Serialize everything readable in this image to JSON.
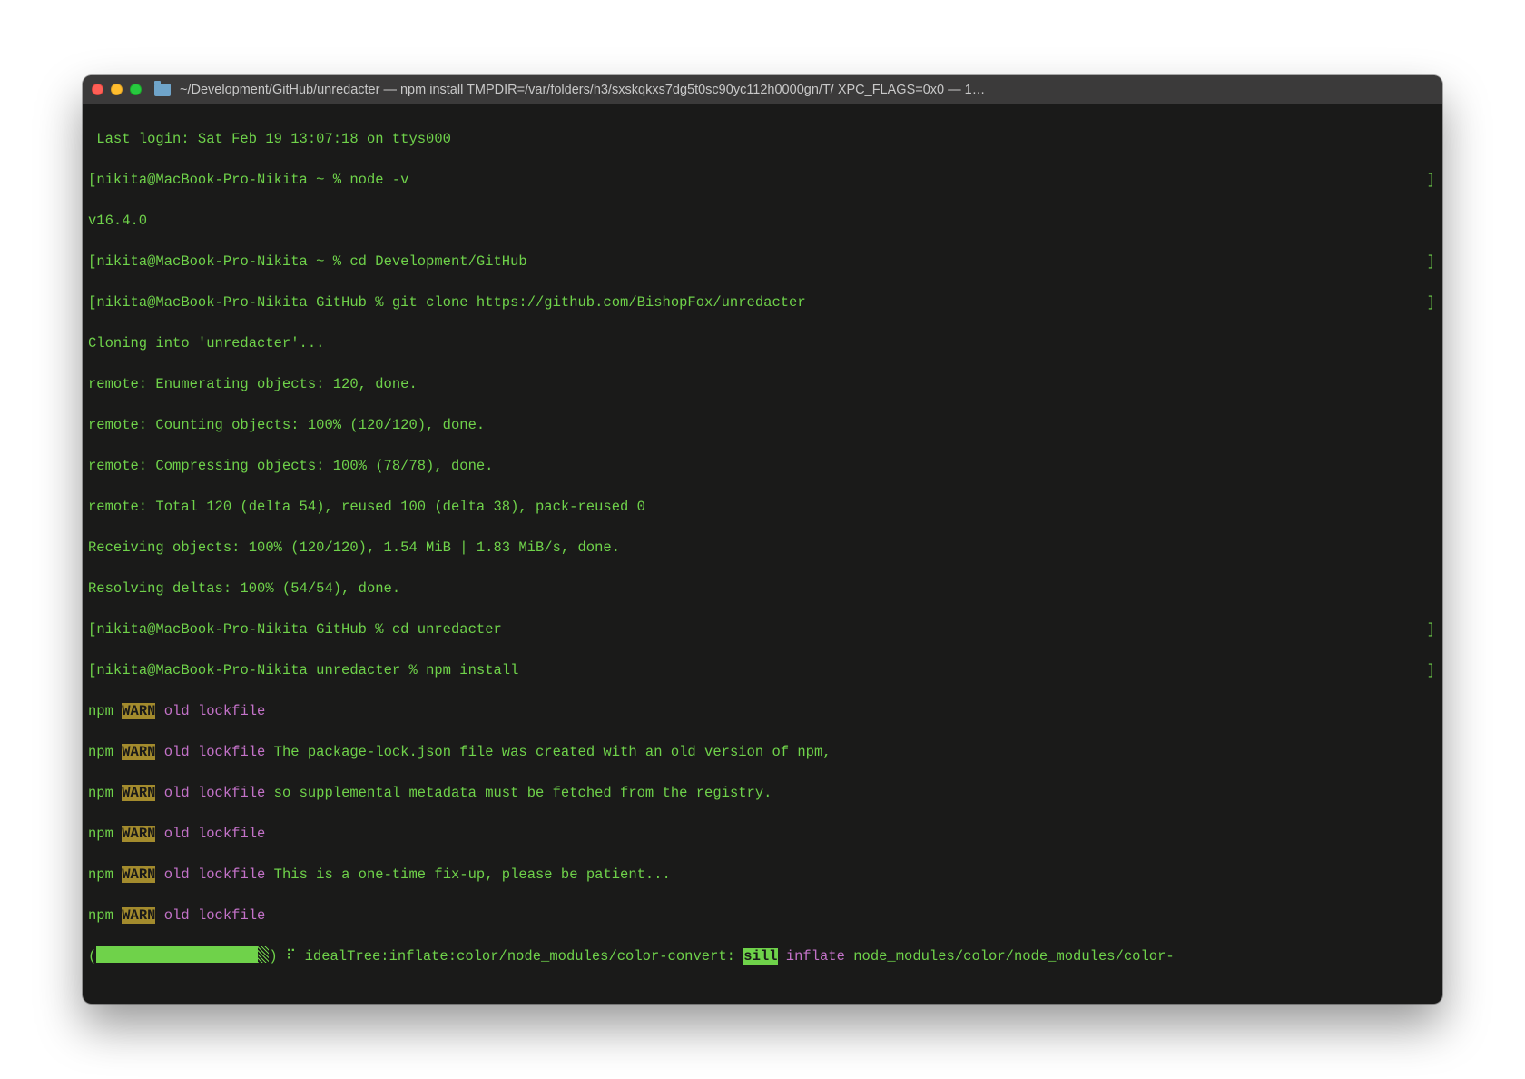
{
  "title": "~/Development/GitHub/unredacter — npm install TMPDIR=/var/folders/h3/sxskqkxs7dg5t0sc90yc112h0000gn/T/ XPC_FLAGS=0x0 — 1…",
  "lines": {
    "last_login": " Last login: Sat Feb 19 13:07:18 on ttys000",
    "p1_left": "nikita@MacBook-Pro-Nikita ~ % ",
    "p1_cmd": "node -v",
    "node_v": "v16.4.0",
    "p2_left": "nikita@MacBook-Pro-Nikita ~ % ",
    "p2_cmd": "cd Development/GitHub",
    "p3_left": "nikita@MacBook-Pro-Nikita GitHub % ",
    "p3_cmd": "git clone https://github.com/BishopFox/unredacter",
    "clone1": "Cloning into 'unredacter'...",
    "clone2": "remote: Enumerating objects: 120, done.",
    "clone3": "remote: Counting objects: 100% (120/120), done.",
    "clone4": "remote: Compressing objects: 100% (78/78), done.",
    "clone5": "remote: Total 120 (delta 54), reused 100 (delta 38), pack-reused 0",
    "clone6": "Receiving objects: 100% (120/120), 1.54 MiB | 1.83 MiB/s, done.",
    "clone7": "Resolving deltas: 100% (54/54), done.",
    "p4_left": "nikita@MacBook-Pro-Nikita GitHub % ",
    "p4_cmd": "cd unredacter",
    "p5_left": "nikita@MacBook-Pro-Nikita unredacter % ",
    "p5_cmd": "npm install",
    "npm": "npm ",
    "warn": "WARN",
    "old_lockfile": " old lockfile",
    "lock_msg1": " The package-lock.json file was created with an old version of npm,",
    "lock_msg2": " so supplemental metadata must be fetched from the registry.",
    "lock_msg3": " This is a one-time fix-up, please be patient...",
    "lbracket": "[",
    "rbracket": "]",
    "prog_open": "(",
    "prog_close": ")",
    "prog_dots": " ⠏ ",
    "prog_task": "idealTree:inflate:color/node_modules/color-convert: ",
    "sill": "sill",
    "inflate_word": " inflate ",
    "inflate_path": "node_modules/color/node_modules/color-"
  }
}
